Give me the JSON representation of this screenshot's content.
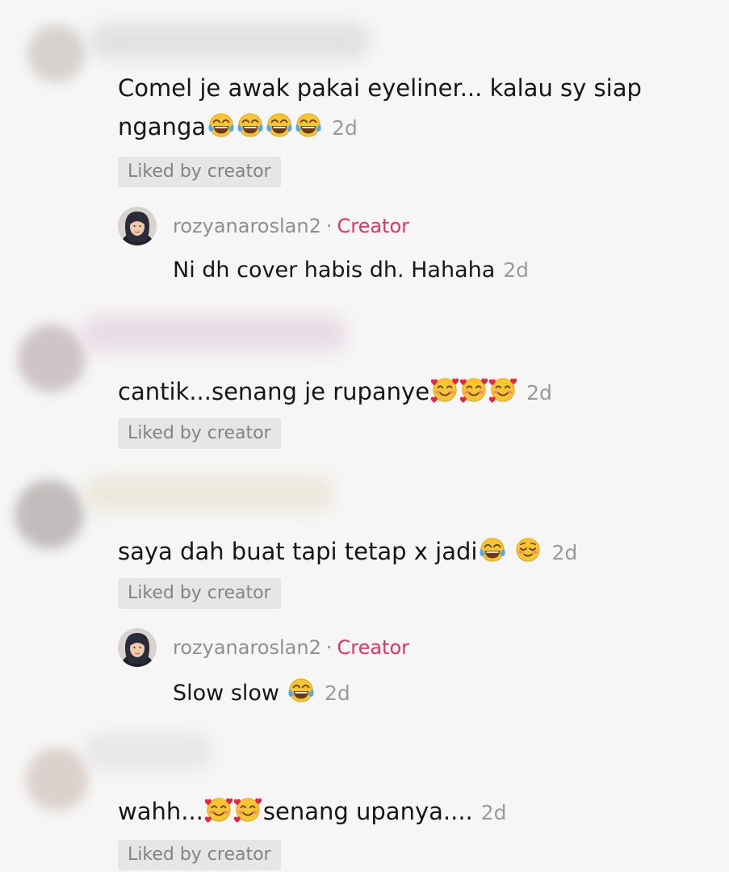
{
  "comments": [
    {
      "text_line1": "Comel je awak pakai eyeliner... kalau sy siap",
      "text_line2": "nganga",
      "emojis": [
        "tears-of-joy",
        "tears-of-joy",
        "tears-of-joy",
        "tears-of-joy"
      ],
      "time": "2d",
      "badge": "Liked by creator",
      "reply": {
        "username": "rozyanaroslan2",
        "separator": "·",
        "role": "Creator",
        "text": "Ni dh cover habis dh. Hahaha",
        "time": "2d"
      }
    },
    {
      "text": "cantik...senang je rupanye",
      "emojis": [
        "smiling-face-with-hearts",
        "smiling-face-with-hearts",
        "smiling-face-with-hearts"
      ],
      "time": "2d",
      "badge": "Liked by creator"
    },
    {
      "text": "saya dah buat tapi tetap x jadi",
      "emojis": [
        "tears-of-joy",
        "relieved-face"
      ],
      "time": "2d",
      "badge": "Liked by creator",
      "reply": {
        "username": "rozyanaroslan2",
        "separator": "·",
        "role": "Creator",
        "text": "Slow slow",
        "emojis": [
          "tears-of-joy"
        ],
        "time": "2d"
      }
    },
    {
      "text_before": "wahh...",
      "emojis": [
        "smiling-face-with-hearts",
        "smiling-face-with-hearts"
      ],
      "text_after": "senang upanya....",
      "time": "2d",
      "badge": "Liked by creator"
    }
  ],
  "colors": {
    "background": "#f6f6f6",
    "creator_accent": "#e8325e",
    "timestamp": "#9a9a9a",
    "badge_bg": "#e6e6e6",
    "badge_text": "#838383"
  }
}
